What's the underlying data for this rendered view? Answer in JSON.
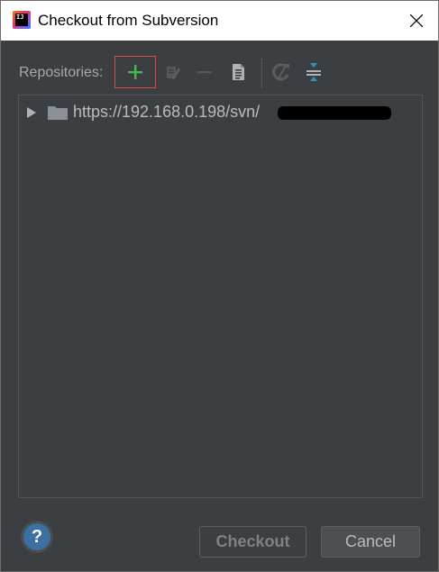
{
  "window": {
    "title": "Checkout from Subversion",
    "app_icon_text": "IJ"
  },
  "toolbar": {
    "label": "Repositories:",
    "buttons": [
      {
        "name": "add",
        "icon": "plus-icon",
        "enabled": true
      },
      {
        "name": "edit",
        "icon": "edit-icon",
        "enabled": false
      },
      {
        "name": "remove",
        "icon": "minus-icon",
        "enabled": false
      },
      {
        "name": "browse",
        "icon": "document-icon",
        "enabled": true
      },
      {
        "name": "refresh",
        "icon": "refresh-icon",
        "enabled": false
      },
      {
        "name": "collapse",
        "icon": "collapse-icon",
        "enabled": true
      }
    ]
  },
  "repositories": [
    {
      "url": "https://192.168.0.198/svn/",
      "redacted_suffix": true,
      "expanded": false
    }
  ],
  "footer": {
    "help_label": "?",
    "checkout_label": "Checkout",
    "checkout_enabled": false,
    "cancel_label": "Cancel"
  },
  "colors": {
    "background": "#3c3f41",
    "add_icon": "#3fb950",
    "highlight_border": "#e24a4a",
    "text": "#bbbbbb",
    "help_blue": "#3d6fa3"
  }
}
